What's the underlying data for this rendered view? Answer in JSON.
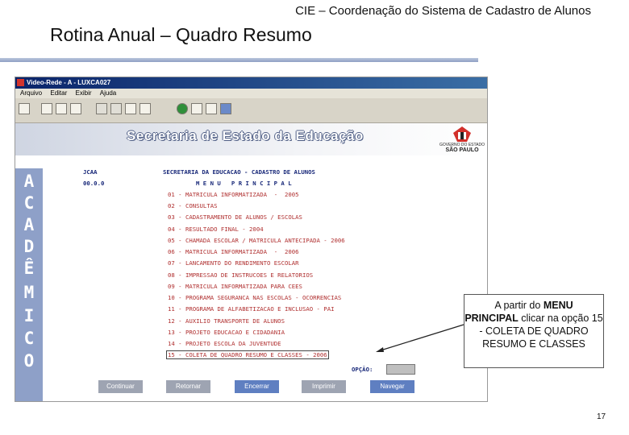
{
  "slide": {
    "header": "CIE – Coordenação do Sistema de Cadastro de Alunos",
    "title": "Rotina Anual – Quadro Resumo",
    "page_number": "17"
  },
  "window": {
    "title": "Video-Rede - A - LUXCA027",
    "menu": [
      "Arquivo",
      "Editar",
      "Exibir",
      "Ajuda"
    ],
    "toolbar_icons": [
      "copy-icon",
      "paste-icon",
      "print-icon",
      "font-a-icon",
      "font-a2-icon",
      "keyboard-icon",
      "grid-icon",
      "help-icon",
      "document-icon",
      "edit-icon",
      "transfer-icon"
    ]
  },
  "banner": {
    "title": "Secretaria de Estado da Educação",
    "logo_top": "GOVERNO DO ESTADO",
    "logo_name": "SÃO PAULO"
  },
  "sidebar": {
    "letters": [
      "A",
      "C",
      "A",
      "D",
      "Ê",
      "M",
      "I",
      "C",
      "O"
    ]
  },
  "terminal": {
    "user": "JCAA",
    "code": "00.0.0",
    "header": "SECRETARIA DA EDUCACAO - CADASTRO DE ALUNOS",
    "menu_title": "M E N U   P R I N C I P A L",
    "items": [
      "01 - MATRICULA INFORMATIZADA  -  2005",
      "02 - CONSULTAS",
      "03 - CADASTRAMENTO DE ALUNOS / ESCOLAS",
      "04 - RESULTADO FINAL - 2004",
      "05 - CHAMADA ESCOLAR / MATRICULA ANTECIPADA - 2006",
      "06 - MATRICULA INFORMATIZADA  -  2006",
      "07 - LANCAMENTO DO RENDIMENTO ESCOLAR",
      "08 - IMPRESSAO DE INSTRUCOES E RELATORIOS",
      "09 - MATRICULA INFORMATIZADA PARA CEES",
      "10 - PROGRAMA SEGURANCA NAS ESCOLAS - OCORRENCIAS",
      "11 - PROGRAMA DE ALFABETIZACAO E INCLUSAO - PAI",
      "12 - AUXILIO TRANSPORTE DE ALUNOS",
      "13 - PROJETO EDUCACAO E CIDADANIA",
      "14 - PROJETO ESCOLA DA JUVENTUDE",
      "15 - COLETA DE QUADRO RESUMO E CLASSES - 2006"
    ],
    "option_label": "OPÇÃO:",
    "option_value": ""
  },
  "buttons": {
    "continuar": "Continuar",
    "retornar": "Retornar",
    "encerrar": "Encerrar",
    "imprimir": "Imprimir",
    "navegar": "Navegar"
  },
  "callout": {
    "line1": "A partir do",
    "bold1": "MENU",
    "bold2": "PRINCIPAL",
    "line2": "clicar na opção 15 - COLETA DE QUADRO RESUMO E CLASSES"
  }
}
